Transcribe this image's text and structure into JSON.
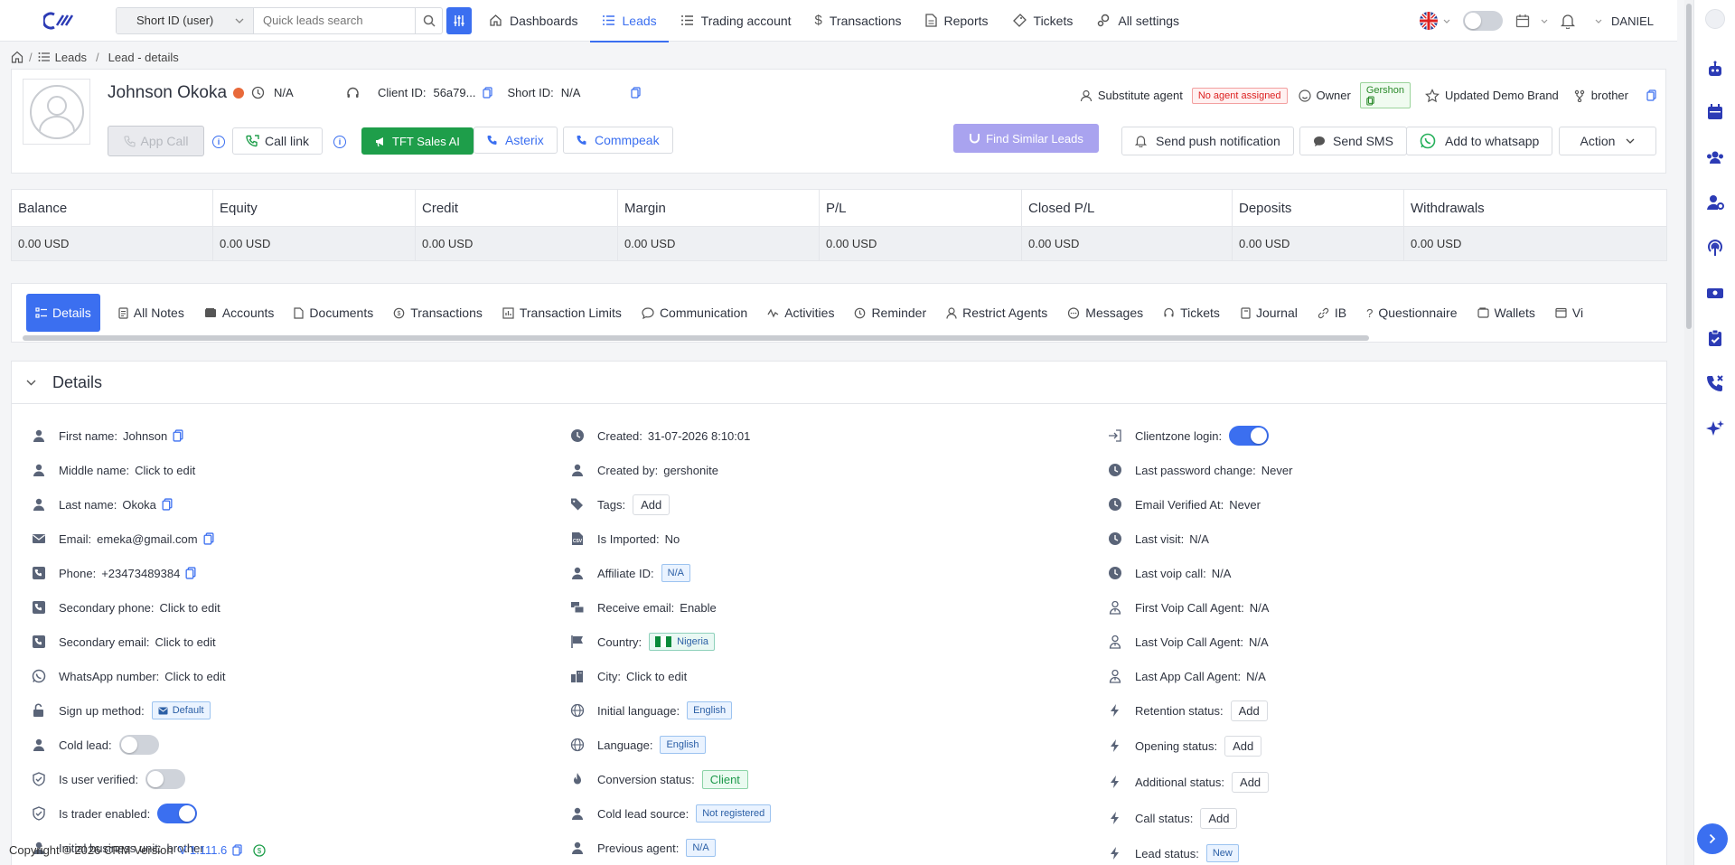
{
  "nav": {
    "search_type": "Short ID (user)",
    "search_placeholder": "Quick leads search",
    "items": [
      "Dashboards",
      "Leads",
      "Trading account",
      "Transactions",
      "Reports",
      "Tickets",
      "All settings"
    ],
    "user": "DANIEL"
  },
  "breadcrumb": [
    "Leads",
    "Lead - details"
  ],
  "lead": {
    "name": "Johnson Okoka",
    "status": "N/A",
    "client_id_label": "Client ID:",
    "client_id": "56a79...",
    "short_id_label": "Short ID:",
    "short_id": "N/A",
    "substitute_label": "Substitute agent",
    "substitute_value": "No agent assigned",
    "owner_label": "Owner",
    "owner_value": "Gershon",
    "brand": "Updated Demo Brand",
    "referrer": "brother"
  },
  "actions": {
    "app_call": "App Call",
    "call_link": "Call link",
    "tft": "TFT Sales AI",
    "asterix": "Asterix",
    "commpeak": "Commpeak",
    "find_similar": "Find Similar Leads",
    "push": "Send push notification",
    "sms": "Send SMS",
    "whatsapp": "Add to whatsapp",
    "action": "Action"
  },
  "summary": [
    {
      "label": "Balance",
      "value": "0.00 USD"
    },
    {
      "label": "Equity",
      "value": "0.00 USD"
    },
    {
      "label": "Credit",
      "value": "0.00 USD"
    },
    {
      "label": "Margin",
      "value": "0.00 USD"
    },
    {
      "label": "P/L",
      "value": "0.00 USD"
    },
    {
      "label": "Closed P/L",
      "value": "0.00 USD"
    },
    {
      "label": "Deposits",
      "value": "0.00 USD"
    },
    {
      "label": "Withdrawals",
      "value": "0.00 USD"
    }
  ],
  "tabs": [
    "Details",
    "All Notes",
    "Accounts",
    "Documents",
    "Transactions",
    "Transaction Limits",
    "Communication",
    "Activities",
    "Reminder",
    "Restrict Agents",
    "Messages",
    "Tickets",
    "Journal",
    "IB",
    "Questionnaire",
    "Wallets",
    "Vi"
  ],
  "details": {
    "title": "Details",
    "col1": [
      {
        "label": "First name",
        "value": "Johnson"
      },
      {
        "label": "Middle name",
        "value": "Click to edit"
      },
      {
        "label": "Last name",
        "value": "Okoka"
      },
      {
        "label": "Email",
        "value": "emeka@gmail.com"
      },
      {
        "label": "Phone",
        "value": "+23473489384"
      },
      {
        "label": "Secondary phone",
        "value": "Click to edit"
      },
      {
        "label": "Secondary email",
        "value": "Click to edit"
      },
      {
        "label": "WhatsApp number",
        "value": "Click to edit"
      },
      {
        "label": "Sign up method",
        "value": "Default"
      },
      {
        "label": "Cold lead",
        "value": "off"
      },
      {
        "label": "Is user verified",
        "value": "off"
      },
      {
        "label": "Is trader enabled",
        "value": "on"
      },
      {
        "label": "Initial business unit",
        "value": "brother"
      }
    ],
    "col2": [
      {
        "label": "Created",
        "value": "31-07-2026 8:10:01"
      },
      {
        "label": "Created by",
        "value": "gershonite"
      },
      {
        "label": "Tags",
        "value": "Add"
      },
      {
        "label": "Is Imported",
        "value": "No"
      },
      {
        "label": "Affiliate ID",
        "value": "N/A"
      },
      {
        "label": "Receive email",
        "value": "Enable"
      },
      {
        "label": "Country",
        "value": "Nigeria"
      },
      {
        "label": "City",
        "value": "Click to edit"
      },
      {
        "label": "Initial language",
        "value": "English"
      },
      {
        "label": "Language",
        "value": "English"
      },
      {
        "label": "Conversion status",
        "value": "Client"
      },
      {
        "label": "Cold lead source",
        "value": "Not registered"
      },
      {
        "label": "Previous agent",
        "value": "N/A"
      }
    ],
    "col3": [
      {
        "label": "Clientzone login",
        "value": "on"
      },
      {
        "label": "Last password change",
        "value": "Never"
      },
      {
        "label": "Email Verified At",
        "value": "Never"
      },
      {
        "label": "Last visit",
        "value": "N/A"
      },
      {
        "label": "Last voip call",
        "value": "N/A"
      },
      {
        "label": "First Voip Call Agent",
        "value": "N/A"
      },
      {
        "label": "Last Voip Call Agent",
        "value": "N/A"
      },
      {
        "label": "Last App Call Agent",
        "value": "N/A"
      },
      {
        "label": "Retention status",
        "value": "Add"
      },
      {
        "label": "Opening status",
        "value": "Add"
      },
      {
        "label": "Additional status",
        "value": "Add"
      },
      {
        "label": "Call status",
        "value": "Add"
      },
      {
        "label": "Lead status",
        "value": "New"
      }
    ]
  },
  "footer": {
    "copyright": "Copyright © 2026 CRM Version",
    "version": "V 1.111.6"
  },
  "colors": {
    "accent": "#3b6ff0",
    "tft": "#1e9e4a",
    "find_similar": "#a9a3ef"
  }
}
